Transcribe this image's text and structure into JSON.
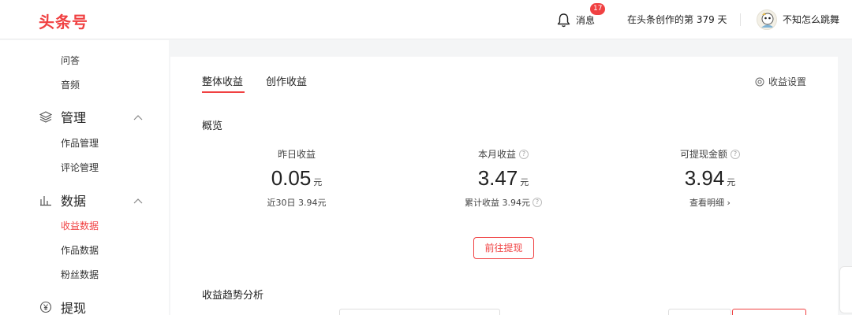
{
  "header": {
    "logo": "头条号",
    "notifications_label": "消息",
    "notifications_count": "17",
    "creation_days": "在头条创作的第 379 天",
    "username": "不知怎么跳舞"
  },
  "sidebar": {
    "items_top": [
      "问答",
      "音频"
    ],
    "groups": [
      {
        "label": "管理",
        "icon": "layers-icon",
        "items": [
          "作品管理",
          "评论管理"
        ]
      },
      {
        "label": "数据",
        "icon": "bar-chart-icon",
        "items": [
          "收益数据",
          "作品数据",
          "粉丝数据"
        ],
        "active": "收益数据"
      },
      {
        "label": "提现",
        "icon": "yen-circle-icon",
        "items": []
      }
    ]
  },
  "main": {
    "tabs": [
      "整体收益",
      "创作收益"
    ],
    "active_tab": "整体收益",
    "settings_label": "收益设置",
    "overview_title": "概览",
    "stats": [
      {
        "label": "昨日收益",
        "value": "0.05",
        "unit": "元",
        "sub": "近30日 3.94元"
      },
      {
        "label": "本月收益",
        "value": "3.47",
        "unit": "元",
        "sub": "累计收益 3.94元"
      },
      {
        "label": "可提现金额",
        "value": "3.94",
        "unit": "元",
        "sub": "查看明细 ›"
      }
    ],
    "withdraw_button": "前往提现",
    "trend_title": "收益趋势分析"
  },
  "colors": {
    "accent": "#f04142",
    "background": "#f4f5f6",
    "card": "#ffffff"
  }
}
